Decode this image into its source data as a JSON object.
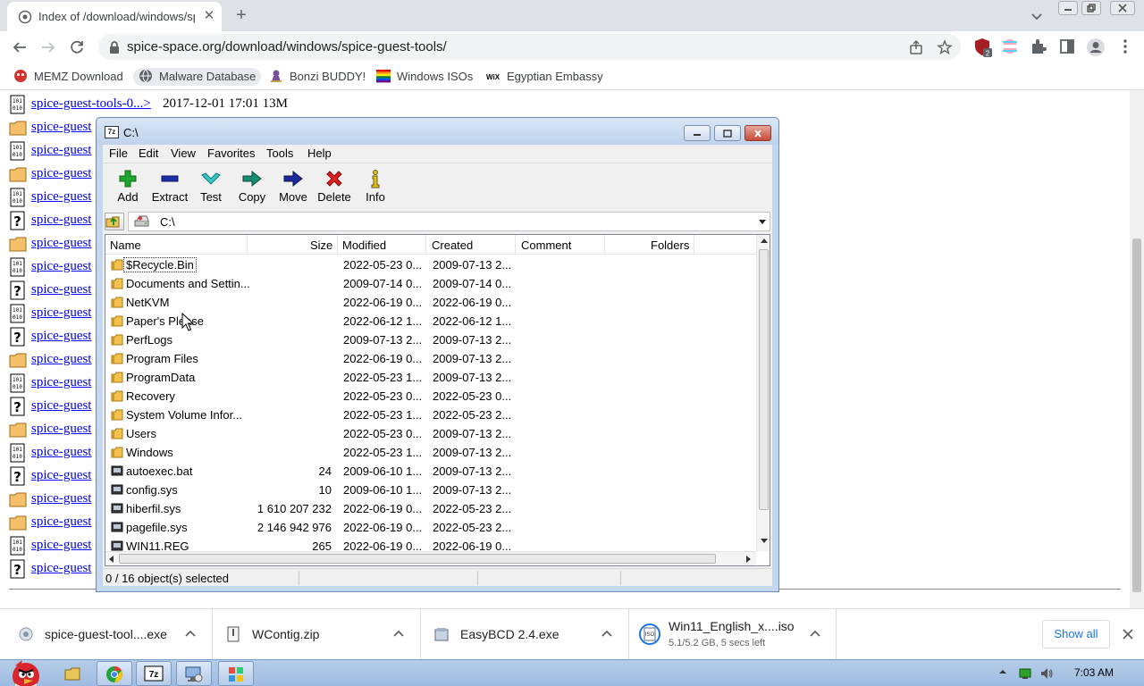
{
  "browser": {
    "tab": {
      "title": "Index of /download/windows/spice-guest-tools/"
    },
    "address_bar": {
      "domain": "spice-space.org",
      "path": "/download/windows/spice-guest-tools/"
    },
    "extension_badge": "2",
    "bookmarks": [
      {
        "label": "MEMZ Download",
        "icon": "memz-icon"
      },
      {
        "label": "Malware Database",
        "icon": "globe-icon"
      },
      {
        "label": "Bonzi BUDDY!",
        "icon": "bonzi-icon"
      },
      {
        "label": "Windows ISOs",
        "icon": "rainbow-flag-icon"
      },
      {
        "label": "Egyptian Embassy",
        "icon": "wix-icon"
      }
    ]
  },
  "directory_listing": {
    "rows": [
      {
        "icon": "binary-icon",
        "name": "spice-guest-tools-0...>",
        "meta": "2017-12-01 17:01  13M"
      },
      {
        "icon": "folder-icon",
        "name": "spice-guest"
      },
      {
        "icon": "binary-icon",
        "name": "spice-guest"
      },
      {
        "icon": "folder-icon",
        "name": "spice-guest"
      },
      {
        "icon": "binary-icon",
        "name": "spice-guest"
      },
      {
        "icon": "unknown-icon",
        "name": "spice-guest"
      },
      {
        "icon": "folder-icon",
        "name": "spice-guest"
      },
      {
        "icon": "binary-icon",
        "name": "spice-guest"
      },
      {
        "icon": "unknown-icon",
        "name": "spice-guest"
      },
      {
        "icon": "binary-icon",
        "name": "spice-guest"
      },
      {
        "icon": "unknown-icon",
        "name": "spice-guest"
      },
      {
        "icon": "folder-icon",
        "name": "spice-guest"
      },
      {
        "icon": "binary-icon",
        "name": "spice-guest"
      },
      {
        "icon": "unknown-icon",
        "name": "spice-guest"
      },
      {
        "icon": "folder-icon",
        "name": "spice-guest"
      },
      {
        "icon": "binary-icon",
        "name": "spice-guest"
      },
      {
        "icon": "unknown-icon",
        "name": "spice-guest"
      },
      {
        "icon": "folder-icon",
        "name": "spice-guest"
      },
      {
        "icon": "folder-icon",
        "name": "spice-guest"
      },
      {
        "icon": "binary-icon",
        "name": "spice-guest"
      },
      {
        "icon": "unknown-icon",
        "name": "spice-guest"
      }
    ]
  },
  "downloads": {
    "items": [
      {
        "name": "spice-guest-tool....exe",
        "sub": ""
      },
      {
        "name": "WContig.zip",
        "sub": ""
      },
      {
        "name": "EasyBCD 2.4.exe",
        "sub": ""
      },
      {
        "name": "Win11_English_x....iso",
        "sub": "5.1/5.2 GB, 5 secs left"
      }
    ],
    "show_all": "Show all"
  },
  "sevenzip": {
    "title": "C:\\",
    "menu": [
      "File",
      "Edit",
      "View",
      "Favorites",
      "Tools",
      "Help"
    ],
    "toolbar": [
      "Add",
      "Extract",
      "Test",
      "Copy",
      "Move",
      "Delete",
      "Info"
    ],
    "address": "C:\\",
    "columns": [
      "Name",
      "Size",
      "Modified",
      "Created",
      "Comment",
      "Folders"
    ],
    "rows": [
      {
        "type": "folder",
        "name": "$Recycle.Bin",
        "size": "",
        "modified": "2022-05-23 0...",
        "created": "2009-07-13 2..."
      },
      {
        "type": "folder",
        "name": "Documents and Settin...",
        "size": "",
        "modified": "2009-07-14 0...",
        "created": "2009-07-14 0..."
      },
      {
        "type": "folder",
        "name": "NetKVM",
        "size": "",
        "modified": "2022-06-19 0...",
        "created": "2022-06-19 0..."
      },
      {
        "type": "folder",
        "name": "Paper's Please",
        "size": "",
        "modified": "2022-06-12 1...",
        "created": "2022-06-12 1..."
      },
      {
        "type": "folder",
        "name": "PerfLogs",
        "size": "",
        "modified": "2009-07-13 2...",
        "created": "2009-07-13 2..."
      },
      {
        "type": "folder",
        "name": "Program Files",
        "size": "",
        "modified": "2022-06-19 0...",
        "created": "2009-07-13 2..."
      },
      {
        "type": "folder",
        "name": "ProgramData",
        "size": "",
        "modified": "2022-05-23 1...",
        "created": "2009-07-13 2..."
      },
      {
        "type": "folder",
        "name": "Recovery",
        "size": "",
        "modified": "2022-05-23 0...",
        "created": "2022-05-23 0..."
      },
      {
        "type": "folder",
        "name": "System Volume Infor...",
        "size": "",
        "modified": "2022-05-23 1...",
        "created": "2022-05-23 2..."
      },
      {
        "type": "folder",
        "name": "Users",
        "size": "",
        "modified": "2022-05-23 0...",
        "created": "2009-07-13 2..."
      },
      {
        "type": "folder",
        "name": "Windows",
        "size": "",
        "modified": "2022-05-23 1...",
        "created": "2009-07-13 2..."
      },
      {
        "type": "file",
        "name": "autoexec.bat",
        "size": "24",
        "modified": "2009-06-10 1...",
        "created": "2009-07-13 2..."
      },
      {
        "type": "file",
        "name": "config.sys",
        "size": "10",
        "modified": "2009-06-10 1...",
        "created": "2009-07-13 2..."
      },
      {
        "type": "file",
        "name": "hiberfil.sys",
        "size": "1 610 207 232",
        "modified": "2022-06-19 0...",
        "created": "2022-05-23 2..."
      },
      {
        "type": "file",
        "name": "pagefile.sys",
        "size": "2 146 942 976",
        "modified": "2022-06-19 0...",
        "created": "2022-05-23 2..."
      },
      {
        "type": "file",
        "name": "WIN11.REG",
        "size": "265",
        "modified": "2022-06-19 0...",
        "created": "2022-06-19 0..."
      }
    ],
    "status": "0 / 16 object(s) selected"
  },
  "taskbar": {
    "clock": "7:03 AM"
  }
}
